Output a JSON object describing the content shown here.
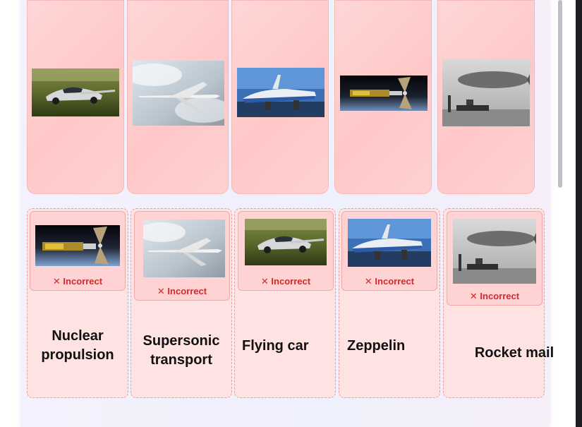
{
  "scroll_tiles": [
    {
      "image": "flying car photo",
      "icon": "flying-car-image"
    },
    {
      "image": "supersonic jet photo",
      "icon": "supersonic-jet-image"
    },
    {
      "image": "ekranoplan photo",
      "icon": "ekranoplan-image"
    },
    {
      "image": "nuclear spacecraft photo",
      "icon": "nuclear-spacecraft-image"
    },
    {
      "image": "zeppelin photo",
      "icon": "zeppelin-image"
    }
  ],
  "columns": [
    {
      "label": "Nuclear propulsion",
      "card_image": "nuclear spacecraft photo",
      "verdict": "✕ Incorrect"
    },
    {
      "label": "Supersonic transport",
      "card_image": "supersonic jet photo",
      "verdict": "✕ Incorrect"
    },
    {
      "label": "Flying car",
      "card_image": "flying car photo",
      "verdict": "✕ Incorrect"
    },
    {
      "label": "Zeppelin",
      "card_image": "ekranoplan photo",
      "verdict": "✕ Incorrect"
    },
    {
      "label": "Rocket mail",
      "card_image": "zeppelin photo",
      "verdict": "✕ Incorrect"
    }
  ],
  "colors": {
    "tile_bg": "#ffcfcf",
    "incorrect": "#d12a2a",
    "dashed_border": "#e7a0a0"
  }
}
